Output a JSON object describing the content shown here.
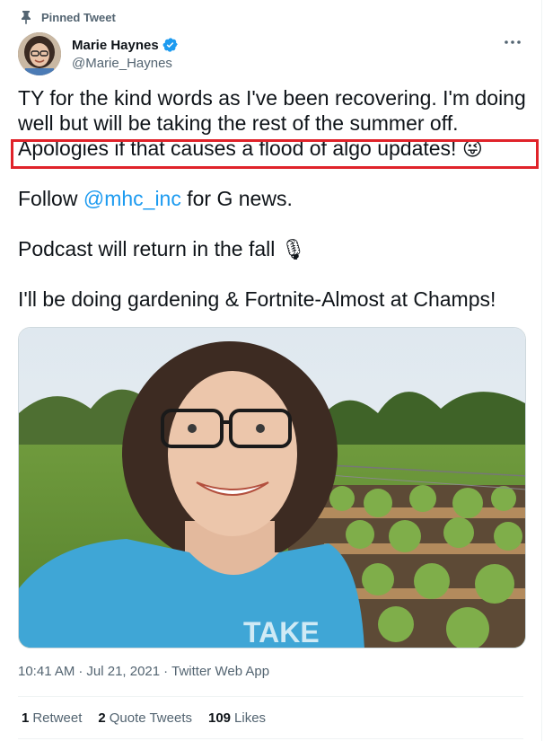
{
  "pinned_label": "Pinned Tweet",
  "author": {
    "name": "Marie Haynes",
    "handle": "@Marie_Haynes",
    "verified_color": "#1d9bf0"
  },
  "tweet": {
    "line1": "TY for the kind words as I've been recovering. I'm doing",
    "line2": "well but will be taking the rest of the summer off.",
    "line3": "Apologies if that causes a flood of algo updates!",
    "line3_emoji": "😜",
    "follow_prefix": "Follow ",
    "mention": "@mhc_inc",
    "follow_suffix": " for G news.",
    "podcast": "Podcast will return in the fall",
    "podcast_emoji": "🎙",
    "gardening": "I'll be doing gardening & Fortnite-Almost at Champs!"
  },
  "meta": {
    "time": "10:41 AM",
    "sep1": "·",
    "date": "Jul 21, 2021",
    "sep2": "·",
    "source": "Twitter Web App"
  },
  "stats": {
    "retweets_count": "1",
    "retweets_label": "Retweet",
    "quotes_count": "2",
    "quotes_label": "Quote Tweets",
    "likes_count": "109",
    "likes_label": "Likes"
  },
  "colors": {
    "accent": "#1d9bf0",
    "highlight": "#e0232a",
    "secondary_text": "#536471"
  }
}
